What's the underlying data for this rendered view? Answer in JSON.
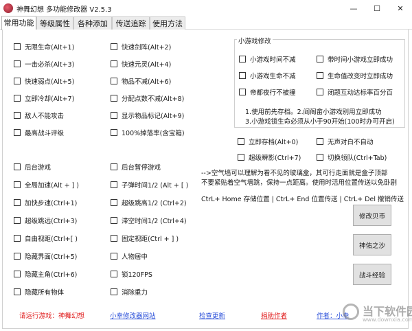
{
  "window": {
    "title": "神舞幻想  多功能修改器  V2.5.3",
    "minimize": "—",
    "maximize": "☐",
    "close": "✕"
  },
  "tabs": [
    "常用功能",
    "等级属性",
    "各种添加",
    "传送追踪",
    "使用方法"
  ],
  "left_column": [
    "无限生命(Alt+1)",
    "一击必杀(Alt+3)",
    "快速弱点(Alt+5)",
    "立即冷却(Alt+7)",
    "敌人不能攻击",
    "最高战斗评级",
    "后台游戏",
    "全局加速(Alt + ] )",
    "加快步速(Ctrl+1)",
    "超级跳远(Ctrl+3)",
    "自由视距(Ctrl+[ )",
    "隐藏界面(Ctrl+5)",
    "隐藏主角(Ctrl+6)",
    "隐藏所有物体"
  ],
  "middle_column": [
    "快速剑阵(Alt+2)",
    "快速元灵(Alt+4)",
    "物品不减(Alt+6)",
    "分配点数不减(Alt+8)",
    "显示物品标记(Alt+9)",
    "100%掉落率(含宝箱)",
    "后台暂停游戏",
    "子弹时间1/2 (Alt + [ )",
    "超级跳高1/2 (Ctrl+2)",
    "滞空时间1/2 (Ctrl+4)",
    "固定视距(Ctrl + ] )",
    "人物居中",
    "锁120FPS",
    "消除重力"
  ],
  "minigame": {
    "title": "小游戏修改",
    "options": [
      "小游戏时间不减",
      "带时间小游戏立即成功",
      "小游戏生命不减",
      "生命值改变时立即成功",
      "帝都夜行不被撞",
      "闭题互动达标率百分百"
    ],
    "notes": [
      "1.使用前先存档。2.阎阁畲小游戏别用立即成功",
      "3.小游戏锁生命必须从小于90开始(100时办可开启)"
    ]
  },
  "right_options": [
    "立即存档(Alt+0)",
    "无声对白不自动",
    "超级瞬影(Ctrl+7)",
    "切换领队(Ctrl+Tab)"
  ],
  "air_wall_notes": [
    "-->空气墙可以理解为看不见的玻璃盒，其可行走面就是盒子顶部",
    "不要紧贴着空气墙跳，保持一点距离。使用时活用位置传送以免卧剧"
  ],
  "teleport_hotkeys": "CtrL+ Home 存储位置 | CtrL+ End 位置传送 | CtrL+ Del 撤销传送",
  "buttons": [
    "修改贝币",
    "神佑之沙",
    "战斗经验"
  ],
  "footer": {
    "game_status": "请运行游戏：神舞幻想",
    "site": "小幸修改器网站",
    "update": "检查更新",
    "donate": "捐助作者",
    "author": "作者：小幸"
  },
  "watermark": {
    "text": "当下软件园",
    "sub": "www.downxia.com"
  },
  "colors": {
    "red": "#e01c1c",
    "blue": "#2a4fd9"
  }
}
